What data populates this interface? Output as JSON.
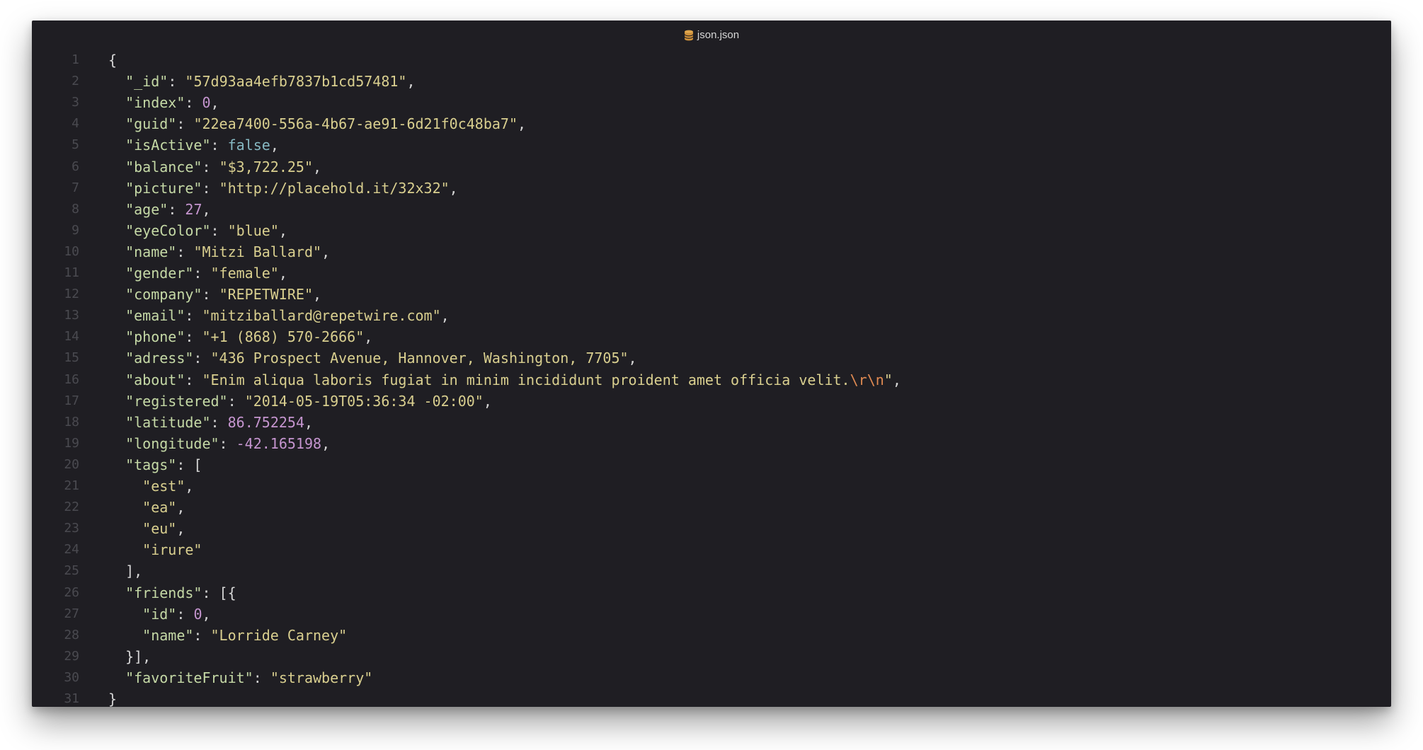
{
  "window": {
    "title": "json.json",
    "title_icon": "database-icon"
  },
  "colors": {
    "background": "#1f1e23",
    "line_number": "#4a4a50",
    "key": "#c5d9a6",
    "string": "#d9cf8f",
    "number": "#c595cf",
    "boolean": "#86b8c2",
    "escape": "#e08a52",
    "punctuation": "#d6d6d6"
  },
  "lines": [
    {
      "n": "1",
      "tokens": [
        {
          "t": "p",
          "v": "{"
        }
      ]
    },
    {
      "n": "2",
      "tokens": [
        {
          "t": "p",
          "v": "  "
        },
        {
          "t": "k",
          "v": "\"_id\""
        },
        {
          "t": "p",
          "v": ": "
        },
        {
          "t": "s",
          "v": "\"57d93aa4efb7837b1cd57481\""
        },
        {
          "t": "p",
          "v": ","
        }
      ]
    },
    {
      "n": "3",
      "tokens": [
        {
          "t": "p",
          "v": "  "
        },
        {
          "t": "k",
          "v": "\"index\""
        },
        {
          "t": "p",
          "v": ": "
        },
        {
          "t": "n",
          "v": "0"
        },
        {
          "t": "p",
          "v": ","
        }
      ]
    },
    {
      "n": "4",
      "tokens": [
        {
          "t": "p",
          "v": "  "
        },
        {
          "t": "k",
          "v": "\"guid\""
        },
        {
          "t": "p",
          "v": ": "
        },
        {
          "t": "s",
          "v": "\"22ea7400-556a-4b67-ae91-6d21f0c48ba7\""
        },
        {
          "t": "p",
          "v": ","
        }
      ]
    },
    {
      "n": "5",
      "tokens": [
        {
          "t": "p",
          "v": "  "
        },
        {
          "t": "k",
          "v": "\"isActive\""
        },
        {
          "t": "p",
          "v": ": "
        },
        {
          "t": "b",
          "v": "false"
        },
        {
          "t": "p",
          "v": ","
        }
      ]
    },
    {
      "n": "6",
      "tokens": [
        {
          "t": "p",
          "v": "  "
        },
        {
          "t": "k",
          "v": "\"balance\""
        },
        {
          "t": "p",
          "v": ": "
        },
        {
          "t": "s",
          "v": "\"$3,722.25\""
        },
        {
          "t": "p",
          "v": ","
        }
      ]
    },
    {
      "n": "7",
      "tokens": [
        {
          "t": "p",
          "v": "  "
        },
        {
          "t": "k",
          "v": "\"picture\""
        },
        {
          "t": "p",
          "v": ": "
        },
        {
          "t": "s",
          "v": "\"http://placehold.it/32x32\""
        },
        {
          "t": "p",
          "v": ","
        }
      ]
    },
    {
      "n": "8",
      "tokens": [
        {
          "t": "p",
          "v": "  "
        },
        {
          "t": "k",
          "v": "\"age\""
        },
        {
          "t": "p",
          "v": ": "
        },
        {
          "t": "n",
          "v": "27"
        },
        {
          "t": "p",
          "v": ","
        }
      ]
    },
    {
      "n": "9",
      "tokens": [
        {
          "t": "p",
          "v": "  "
        },
        {
          "t": "k",
          "v": "\"eyeColor\""
        },
        {
          "t": "p",
          "v": ": "
        },
        {
          "t": "s",
          "v": "\"blue\""
        },
        {
          "t": "p",
          "v": ","
        }
      ]
    },
    {
      "n": "10",
      "tokens": [
        {
          "t": "p",
          "v": "  "
        },
        {
          "t": "k",
          "v": "\"name\""
        },
        {
          "t": "p",
          "v": ": "
        },
        {
          "t": "s",
          "v": "\"Mitzi Ballard\""
        },
        {
          "t": "p",
          "v": ","
        }
      ]
    },
    {
      "n": "11",
      "tokens": [
        {
          "t": "p",
          "v": "  "
        },
        {
          "t": "k",
          "v": "\"gender\""
        },
        {
          "t": "p",
          "v": ": "
        },
        {
          "t": "s",
          "v": "\"female\""
        },
        {
          "t": "p",
          "v": ","
        }
      ]
    },
    {
      "n": "12",
      "tokens": [
        {
          "t": "p",
          "v": "  "
        },
        {
          "t": "k",
          "v": "\"company\""
        },
        {
          "t": "p",
          "v": ": "
        },
        {
          "t": "s",
          "v": "\"REPETWIRE\""
        },
        {
          "t": "p",
          "v": ","
        }
      ]
    },
    {
      "n": "13",
      "tokens": [
        {
          "t": "p",
          "v": "  "
        },
        {
          "t": "k",
          "v": "\"email\""
        },
        {
          "t": "p",
          "v": ": "
        },
        {
          "t": "s",
          "v": "\"mitziballard@repetwire.com\""
        },
        {
          "t": "p",
          "v": ","
        }
      ]
    },
    {
      "n": "14",
      "tokens": [
        {
          "t": "p",
          "v": "  "
        },
        {
          "t": "k",
          "v": "\"phone\""
        },
        {
          "t": "p",
          "v": ": "
        },
        {
          "t": "s",
          "v": "\"+1 (868) 570-2666\""
        },
        {
          "t": "p",
          "v": ","
        }
      ]
    },
    {
      "n": "15",
      "tokens": [
        {
          "t": "p",
          "v": "  "
        },
        {
          "t": "k",
          "v": "\"adress\""
        },
        {
          "t": "p",
          "v": ": "
        },
        {
          "t": "s",
          "v": "\"436 Prospect Avenue, Hannover, Washington, 7705\""
        },
        {
          "t": "p",
          "v": ","
        }
      ]
    },
    {
      "n": "16",
      "tokens": [
        {
          "t": "p",
          "v": "  "
        },
        {
          "t": "k",
          "v": "\"about\""
        },
        {
          "t": "p",
          "v": ": "
        },
        {
          "t": "s",
          "v": "\"Enim aliqua laboris fugiat in minim incididunt proident amet officia velit."
        },
        {
          "t": "e",
          "v": "\\r\\n"
        },
        {
          "t": "s",
          "v": "\""
        },
        {
          "t": "p",
          "v": ","
        }
      ]
    },
    {
      "n": "17",
      "tokens": [
        {
          "t": "p",
          "v": "  "
        },
        {
          "t": "k",
          "v": "\"registered\""
        },
        {
          "t": "p",
          "v": ": "
        },
        {
          "t": "s",
          "v": "\"2014-05-19T05:36:34 -02:00\""
        },
        {
          "t": "p",
          "v": ","
        }
      ]
    },
    {
      "n": "18",
      "tokens": [
        {
          "t": "p",
          "v": "  "
        },
        {
          "t": "k",
          "v": "\"latitude\""
        },
        {
          "t": "p",
          "v": ": "
        },
        {
          "t": "n",
          "v": "86.752254"
        },
        {
          "t": "p",
          "v": ","
        }
      ]
    },
    {
      "n": "19",
      "tokens": [
        {
          "t": "p",
          "v": "  "
        },
        {
          "t": "k",
          "v": "\"longitude\""
        },
        {
          "t": "p",
          "v": ": "
        },
        {
          "t": "n",
          "v": "-42.165198"
        },
        {
          "t": "p",
          "v": ","
        }
      ]
    },
    {
      "n": "20",
      "tokens": [
        {
          "t": "p",
          "v": "  "
        },
        {
          "t": "k",
          "v": "\"tags\""
        },
        {
          "t": "p",
          "v": ": ["
        }
      ]
    },
    {
      "n": "21",
      "tokens": [
        {
          "t": "p",
          "v": "    "
        },
        {
          "t": "s",
          "v": "\"est\""
        },
        {
          "t": "p",
          "v": ","
        }
      ]
    },
    {
      "n": "22",
      "tokens": [
        {
          "t": "p",
          "v": "    "
        },
        {
          "t": "s",
          "v": "\"ea\""
        },
        {
          "t": "p",
          "v": ","
        }
      ]
    },
    {
      "n": "23",
      "tokens": [
        {
          "t": "p",
          "v": "    "
        },
        {
          "t": "s",
          "v": "\"eu\""
        },
        {
          "t": "p",
          "v": ","
        }
      ]
    },
    {
      "n": "24",
      "tokens": [
        {
          "t": "p",
          "v": "    "
        },
        {
          "t": "s",
          "v": "\"irure\""
        }
      ]
    },
    {
      "n": "25",
      "tokens": [
        {
          "t": "p",
          "v": "  ],"
        }
      ]
    },
    {
      "n": "26",
      "tokens": [
        {
          "t": "p",
          "v": "  "
        },
        {
          "t": "k",
          "v": "\"friends\""
        },
        {
          "t": "p",
          "v": ": [{"
        }
      ]
    },
    {
      "n": "27",
      "tokens": [
        {
          "t": "p",
          "v": "    "
        },
        {
          "t": "k",
          "v": "\"id\""
        },
        {
          "t": "p",
          "v": ": "
        },
        {
          "t": "n",
          "v": "0"
        },
        {
          "t": "p",
          "v": ","
        }
      ]
    },
    {
      "n": "28",
      "tokens": [
        {
          "t": "p",
          "v": "    "
        },
        {
          "t": "k",
          "v": "\"name\""
        },
        {
          "t": "p",
          "v": ": "
        },
        {
          "t": "s",
          "v": "\"Lorride Carney\""
        }
      ]
    },
    {
      "n": "29",
      "tokens": [
        {
          "t": "p",
          "v": "  }],"
        }
      ]
    },
    {
      "n": "30",
      "tokens": [
        {
          "t": "p",
          "v": "  "
        },
        {
          "t": "k",
          "v": "\"favoriteFruit\""
        },
        {
          "t": "p",
          "v": ": "
        },
        {
          "t": "s",
          "v": "\"strawberry\""
        }
      ]
    },
    {
      "n": "31",
      "tokens": [
        {
          "t": "p",
          "v": "}"
        }
      ]
    }
  ]
}
